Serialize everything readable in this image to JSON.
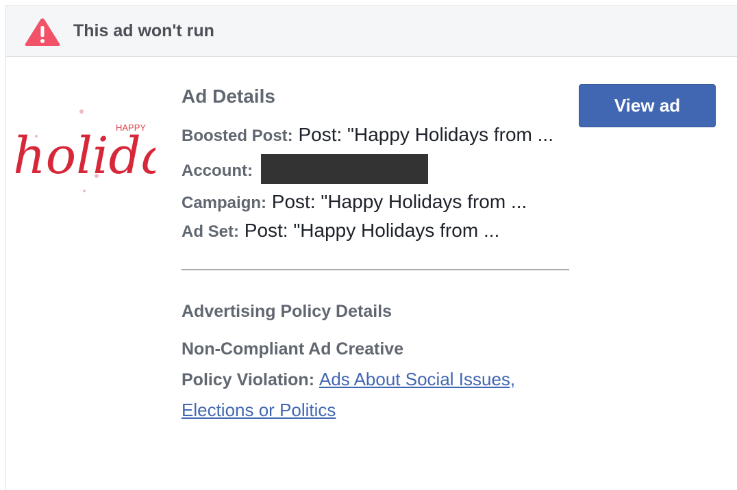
{
  "banner": {
    "icon": "warning-triangle-icon",
    "title": "This ad won't run",
    "icon_color": "#f25268"
  },
  "thumbnail": {
    "text_main": "holidays",
    "text_small": "HAPPY"
  },
  "ad_details": {
    "title": "Ad Details",
    "boosted_post_label": "Boosted Post:",
    "boosted_post_value": "Post: \"Happy Holidays from ...",
    "account_label": "Account:",
    "campaign_label": "Campaign:",
    "campaign_value": "Post: \"Happy Holidays from ...",
    "ad_set_label": "Ad Set:",
    "ad_set_value": "Post: \"Happy Holidays from ..."
  },
  "policy": {
    "title": "Advertising Policy Details",
    "reason": "Non-Compliant Ad Creative",
    "violation_label": "Policy Violation:",
    "violation_link": "Ads About Social Issues, Elections or Politics"
  },
  "actions": {
    "view_ad_label": "View ad",
    "button_color": "#4267b2"
  }
}
